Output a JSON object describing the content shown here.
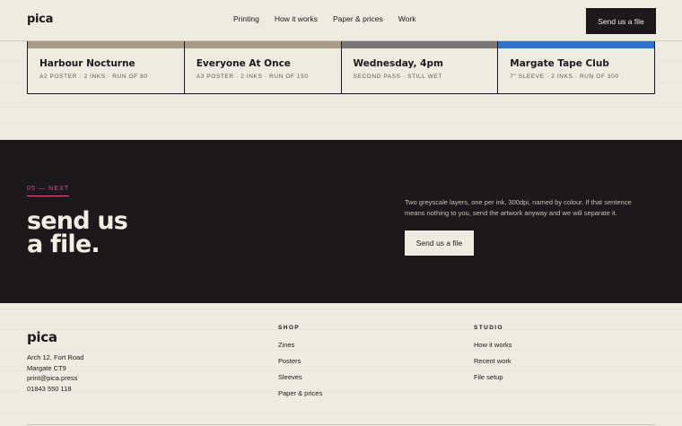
{
  "nav": {
    "logo": "pica",
    "links": [
      "Printing",
      "How it works",
      "Paper & prices",
      "Work"
    ],
    "cta": "Send us a file"
  },
  "cards": [
    {
      "title": "Harbour Nocturne",
      "meta": "A2 POSTER · 2 INKS · RUN OF 80",
      "color": "#a89c87"
    },
    {
      "title": "Everyone At Once",
      "meta": "A3 POSTER · 2 INKS · RUN OF 150",
      "color": "#a89c87"
    },
    {
      "title": "Wednesday, 4pm",
      "meta": "SECOND PASS · STILL WET",
      "color": "#7a7875"
    },
    {
      "title": "Margate Tape Club",
      "meta": "7\" SLEEVE · 2 INKS · RUN OF 300",
      "color": "#2d74cc"
    }
  ],
  "cta_band": {
    "eyebrow": "05 — NEXT",
    "title_line1": "send us",
    "title_line2": "a file.",
    "body": "Two greyscale layers, one per ink, 300dpi, named by colour. If that sentence means nothing to you, send the artwork anyway and we will separate it.",
    "button": "Send us a file"
  },
  "footer": {
    "logo": "pica",
    "address": [
      "Arch 12, Fort Road",
      "Margate CT9",
      "print@pica.press",
      "01843 550 118"
    ],
    "shop": {
      "heading": "SHOP",
      "links": [
        "Zines",
        "Posters",
        "Sleeves",
        "Paper & prices"
      ]
    },
    "studio": {
      "heading": "STUDIO",
      "links": [
        "How it works",
        "Recent work",
        "File setup"
      ]
    }
  },
  "colors": {
    "background": "#eeebe0",
    "ink": "#1c181c",
    "accent_pink": "#e0508a",
    "accent_blue": "#2d74cc"
  }
}
